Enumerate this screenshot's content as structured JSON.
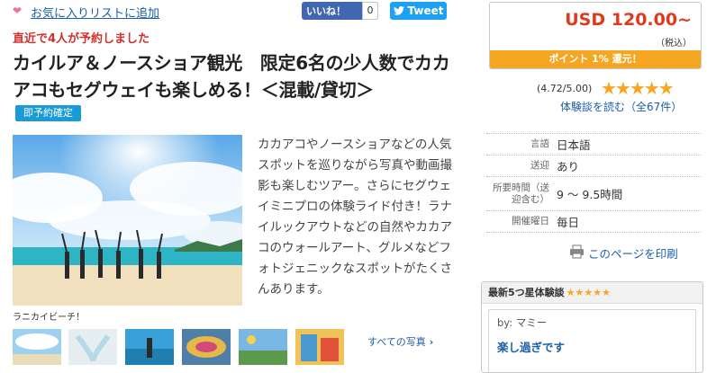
{
  "favorite": {
    "link": "お気に入りリストに追加",
    "icon": "heart-icon"
  },
  "social": {
    "like_label": "いいね！",
    "like_count": "0",
    "tweet_label": "Tweet"
  },
  "booking_notice": "直近で4人が予約しました",
  "tour": {
    "title": "カイルア＆ノースショア観光　限定6名の少人数でカカアコもセグウェイも楽しめる！＜混載/貸切＞",
    "badge": "即予約確定",
    "photo_caption": "ラニカイビーチ！",
    "description": "カカアコやノースショアなどの人気スポットを巡りながら写真や動画撮影も楽しむツアー。さらにセグウェイミニプロの体験ライド付き！ラナイルックアウトなどの自然やカカアコのウォールアート、グルメなどフォトジェニックなスポットがたくさんあります。",
    "all_photos": "すべての写真",
    "thumbnail_count": 6
  },
  "price": {
    "amount": "USD 120.00~",
    "tax_note": "（税込）",
    "points": "ポイント 1% 還元！"
  },
  "rating": {
    "score": "(4.72/5.00)",
    "stars": 5,
    "reviews_link": "体験談を読む（全67件）"
  },
  "info": [
    {
      "key": "言語",
      "value": "日本語"
    },
    {
      "key": "送迎",
      "value": "あり"
    },
    {
      "key": "所要時間（送迎含む）",
      "value": "9 ～ 9.5時間"
    },
    {
      "key": "開催曜日",
      "value": "毎日"
    }
  ],
  "print_link": "このページを印刷",
  "latest_review": {
    "heading": "最新5つ星体験談",
    "stars": "★★★★★",
    "author": "by: マミー",
    "title": "楽し過ぎです"
  },
  "colors": {
    "link": "#1a5fa8",
    "price": "#e03a1e",
    "accent_orange": "#f5a623",
    "notice_red": "#d0312d",
    "badge_blue": "#1a9bd7",
    "facebook": "#4267b2",
    "twitter": "#1da1f2"
  }
}
